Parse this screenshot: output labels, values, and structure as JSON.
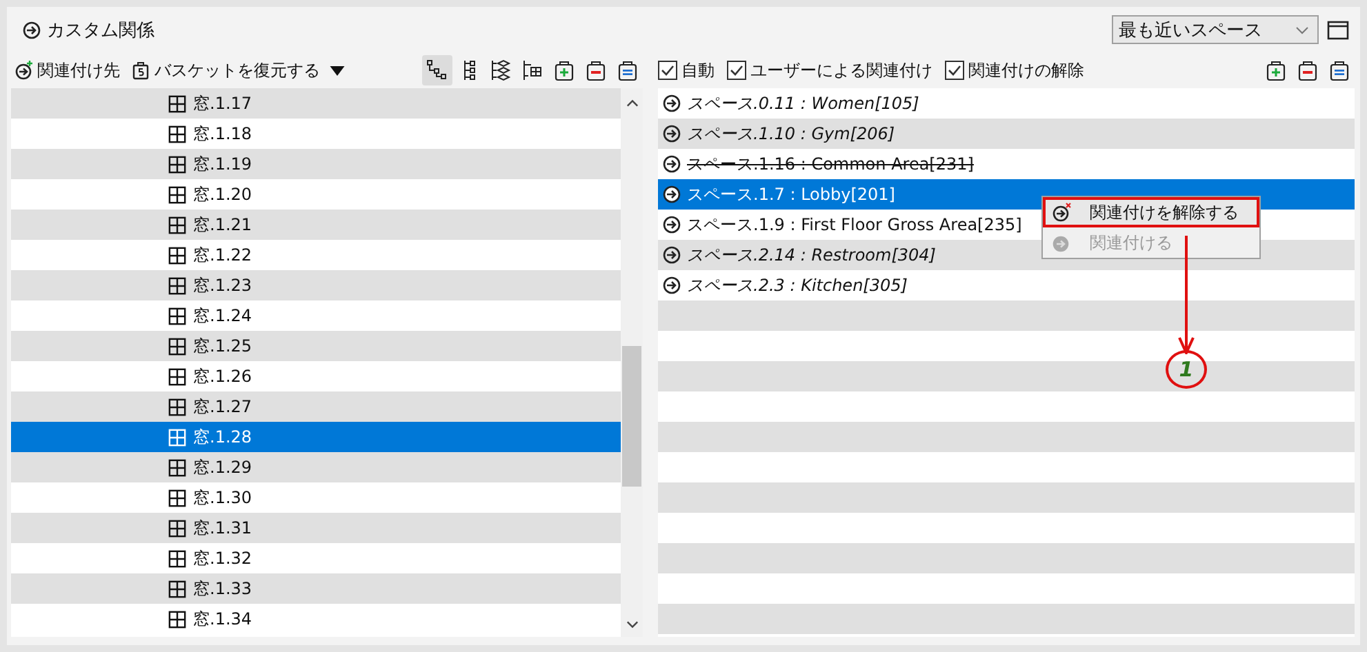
{
  "title": "カスタム関係",
  "scope_select": {
    "value": "最も近いスペース"
  },
  "left_toolbar": {
    "associate_label": "関連付け先",
    "restore_label": "バスケットを復元する"
  },
  "left_tools": [
    {
      "kind": "tree",
      "selected": true
    },
    {
      "kind": "list-tree",
      "selected": false
    },
    {
      "kind": "layers",
      "selected": false
    },
    {
      "kind": "hierarchy",
      "selected": false
    },
    {
      "kind": "basket-add",
      "selected": false
    },
    {
      "kind": "basket-remove",
      "selected": false
    },
    {
      "kind": "basket",
      "selected": false
    }
  ],
  "filters": [
    {
      "label": "自動",
      "checked": true
    },
    {
      "label": "ユーザーによる関連付け",
      "checked": true
    },
    {
      "label": "関連付けの解除",
      "checked": true
    }
  ],
  "right_tools": [
    {
      "kind": "basket-add"
    },
    {
      "kind": "basket-remove"
    },
    {
      "kind": "basket"
    }
  ],
  "windows": [
    {
      "label": "窓.1.17",
      "selected": false
    },
    {
      "label": "窓.1.18",
      "selected": false
    },
    {
      "label": "窓.1.19",
      "selected": false
    },
    {
      "label": "窓.1.20",
      "selected": false
    },
    {
      "label": "窓.1.21",
      "selected": false
    },
    {
      "label": "窓.1.22",
      "selected": false
    },
    {
      "label": "窓.1.23",
      "selected": false
    },
    {
      "label": "窓.1.24",
      "selected": false
    },
    {
      "label": "窓.1.25",
      "selected": false
    },
    {
      "label": "窓.1.26",
      "selected": false
    },
    {
      "label": "窓.1.27",
      "selected": false
    },
    {
      "label": "窓.1.28",
      "selected": true
    },
    {
      "label": "窓.1.29",
      "selected": false
    },
    {
      "label": "窓.1.30",
      "selected": false
    },
    {
      "label": "窓.1.31",
      "selected": false
    },
    {
      "label": "窓.1.32",
      "selected": false
    },
    {
      "label": "窓.1.33",
      "selected": false
    },
    {
      "label": "窓.1.34",
      "selected": false
    }
  ],
  "spaces": [
    {
      "label": "スペース.0.11 : Women[105]",
      "kind": "auto",
      "selected": false
    },
    {
      "label": "スペース.1.10 : Gym[206]",
      "kind": "auto",
      "selected": false
    },
    {
      "label": "スペース.1.16 : Common Area[231]",
      "kind": "removed",
      "selected": false
    },
    {
      "label": "スペース.1.7 : Lobby[201]",
      "kind": "user",
      "selected": true
    },
    {
      "label": "スペース.1.9 : First Floor Gross Area[235]",
      "kind": "user",
      "selected": false
    },
    {
      "label": "スペース.2.14 : Restroom[304]",
      "kind": "auto",
      "selected": false
    },
    {
      "label": "スペース.2.3 : Kitchen[305]",
      "kind": "auto",
      "selected": false
    }
  ],
  "context_menu": [
    {
      "label": "関連付けを解除する",
      "kind": "disassociate",
      "disabled": false,
      "outlined": true
    },
    {
      "label": "関連付ける",
      "kind": "associate",
      "disabled": true,
      "outlined": false
    }
  ],
  "callout": {
    "label": "1"
  }
}
